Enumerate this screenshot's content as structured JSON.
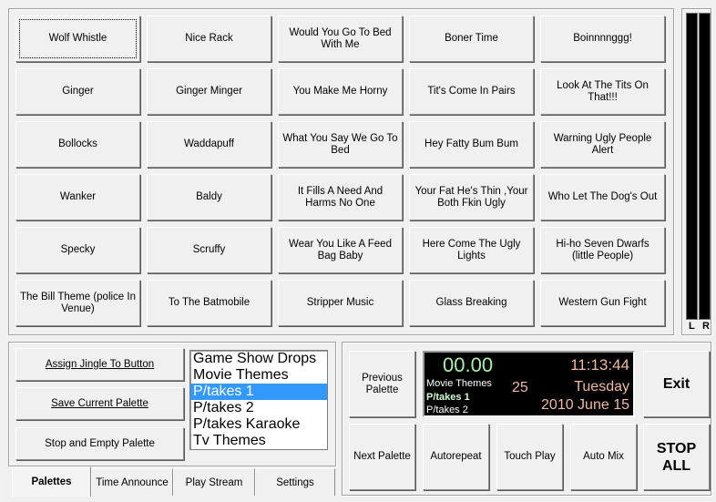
{
  "jingles": [
    [
      "Wolf Whistle",
      "Nice Rack",
      "Would You Go To Bed With Me",
      "Boner Time",
      "Boinnnnggg!"
    ],
    [
      "Ginger",
      "Ginger Minger",
      "You Make Me Horny",
      "Tit's Come In Pairs",
      "Look At The Tits On That!!!"
    ],
    [
      "Bollocks",
      "Waddapuff",
      "What You Say We Go To Bed",
      "Hey Fatty Bum Bum",
      "Warning Ugly People Alert"
    ],
    [
      "Wanker",
      "Baldy",
      "It Fills A Need And Harms No One",
      "Your Fat He's Thin ,Your Both Fkin Ugly",
      "Who Let The Dog's Out"
    ],
    [
      "Specky",
      "Scruffy",
      "Wear You Like A Feed Bag Baby",
      "Here Come The Ugly Lights",
      "Hi-ho Seven Dwarfs (little People)"
    ],
    [
      "The Bill Theme (police In Venue)",
      "To The Batmobile",
      "Stripper Music",
      "Glass Breaking",
      "Western Gun Fight"
    ]
  ],
  "meters": {
    "left_label": "L",
    "right_label": "R"
  },
  "palette_actions": {
    "assign_label": "Assign Jingle To Button",
    "save_label": "Save Current Palette",
    "stop_empty_label": "Stop and Empty Palette"
  },
  "palette_list": {
    "items": [
      "Game Show Drops",
      "Movie Themes",
      "P/takes 1",
      "P/takes 2",
      "P/takes Karaoke",
      "Tv Themes"
    ],
    "selected": "P/takes 1"
  },
  "tabs": [
    "Palettes",
    "Time Announce",
    "Play Stream",
    "Settings"
  ],
  "active_tab": "Palettes",
  "transport": {
    "previous_palette_label": "Previous Palette",
    "next_palette_label": "Next Palette",
    "autorepeat_label": "Autorepeat",
    "touch_play_label": "Touch Play",
    "auto_mix_label": "Auto Mix",
    "exit_label": "Exit",
    "stop_all_label": "STOP ALL"
  },
  "display": {
    "counter": "00.00",
    "time": "11:13:44",
    "palette_prev": "Movie Themes",
    "palette_current": "P/takes 1",
    "palette_next": "P/takes 2",
    "count": "25",
    "weekday": "Tuesday",
    "date": "2010 June 15",
    "colors": {
      "counter": "#a8f0a8",
      "time": "#f4b8a0",
      "text": "#ffffff",
      "accent": "#ccffcc"
    }
  }
}
